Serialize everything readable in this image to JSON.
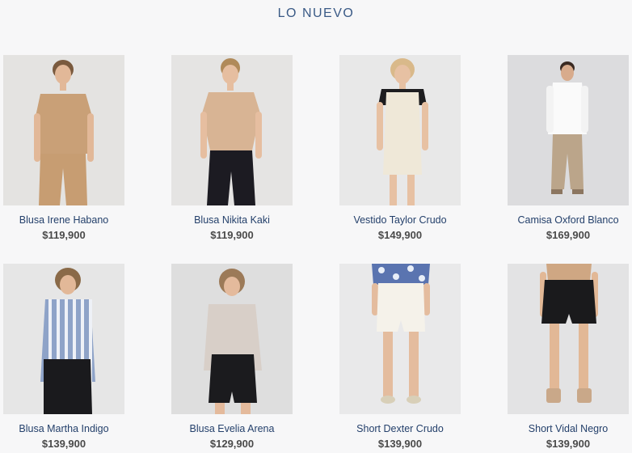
{
  "section": {
    "title": "LO NUEVO"
  },
  "products": [
    {
      "name": "Blusa Irene Habano",
      "price": "$119,900",
      "figure": "woman-tan-set"
    },
    {
      "name": "Blusa Nikita Kaki",
      "price": "$119,900",
      "figure": "woman-tan-top-black-pants"
    },
    {
      "name": "Vestido Taylor Crudo",
      "price": "$149,900",
      "figure": "woman-cream-dress"
    },
    {
      "name": "Camisa Oxford Blanco",
      "price": "$169,900",
      "figure": "man-white-shirt"
    },
    {
      "name": "Blusa Martha Indigo",
      "price": "$139,900",
      "figure": "woman-striped-shirt"
    },
    {
      "name": "Blusa Evelia Arena",
      "price": "$129,900",
      "figure": "woman-sand-shirt-black-shorts"
    },
    {
      "name": "Short Dexter Crudo",
      "price": "$139,900",
      "figure": "woman-cream-shorts"
    },
    {
      "name": "Short Vidal Negro",
      "price": "$139,900",
      "figure": "woman-black-shorts"
    }
  ],
  "colors": {
    "background": "#f7f7f8",
    "photo_bg": "#e2e2e4",
    "name_text": "#24406b",
    "price_text": "#4a4a4a"
  }
}
